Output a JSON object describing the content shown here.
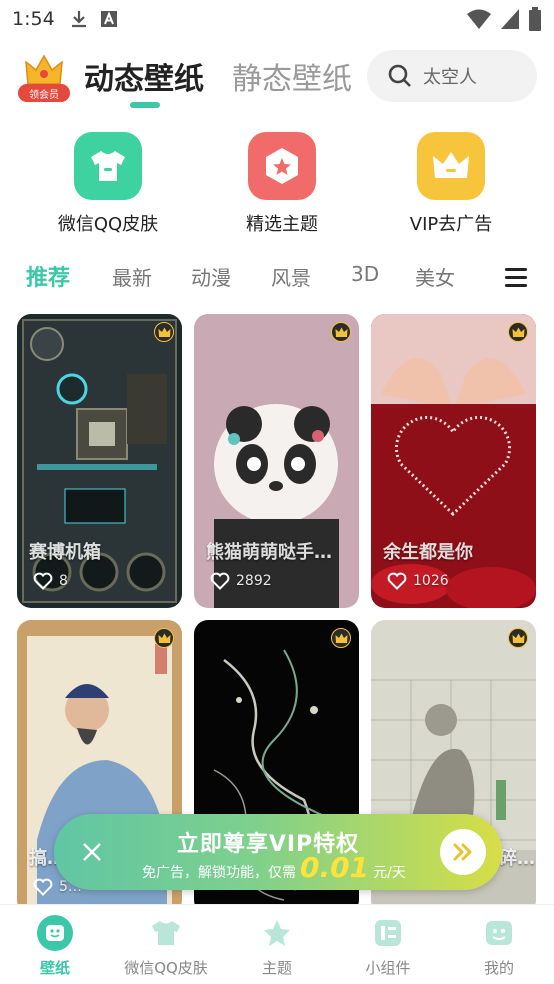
{
  "status_bar": {
    "time": "1:54"
  },
  "header": {
    "vip_badge_label": "领会员",
    "tab_dynamic": "动态壁纸",
    "tab_static": "静态壁纸",
    "search_placeholder": "太空人"
  },
  "quick_entries": [
    {
      "label": "微信QQ皮肤",
      "icon": "shirt-icon",
      "color": "#3ed2a0"
    },
    {
      "label": "精选主题",
      "icon": "star-hexagon-icon",
      "color": "#f26b6b"
    },
    {
      "label": "VIP去广告",
      "icon": "crown-icon",
      "color": "#f7c53c"
    }
  ],
  "categories": [
    "推荐",
    "最新",
    "动漫",
    "风景",
    "3D",
    "美女"
  ],
  "cards": [
    {
      "title": "赛博机箱",
      "likes": "8",
      "vip": true
    },
    {
      "title": "熊猫萌萌哒手…",
      "likes": "2892",
      "vip": true
    },
    {
      "title": "余生都是你",
      "likes": "1026",
      "vip": true
    },
    {
      "title": "搞…",
      "likes": "5…",
      "vip": true
    },
    {
      "title": "",
      "likes": "",
      "vip": true
    },
    {
      "title": "…碎…",
      "likes": "",
      "vip": true
    }
  ],
  "vip_banner": {
    "title": "立即尊享VIP特权",
    "subtitle_before": "免广告，解锁功能，仅需",
    "price": "0.01",
    "unit": "元/天"
  },
  "bottom_nav": [
    {
      "label": "壁纸",
      "active": true
    },
    {
      "label": "微信QQ皮肤",
      "active": false
    },
    {
      "label": "主题",
      "active": false
    },
    {
      "label": "小组件",
      "active": false
    },
    {
      "label": "我的",
      "active": false
    }
  ],
  "colors": {
    "accent": "#3cc8a8",
    "vip_gold": "#f3c23a",
    "badge_red": "#e5483c"
  }
}
